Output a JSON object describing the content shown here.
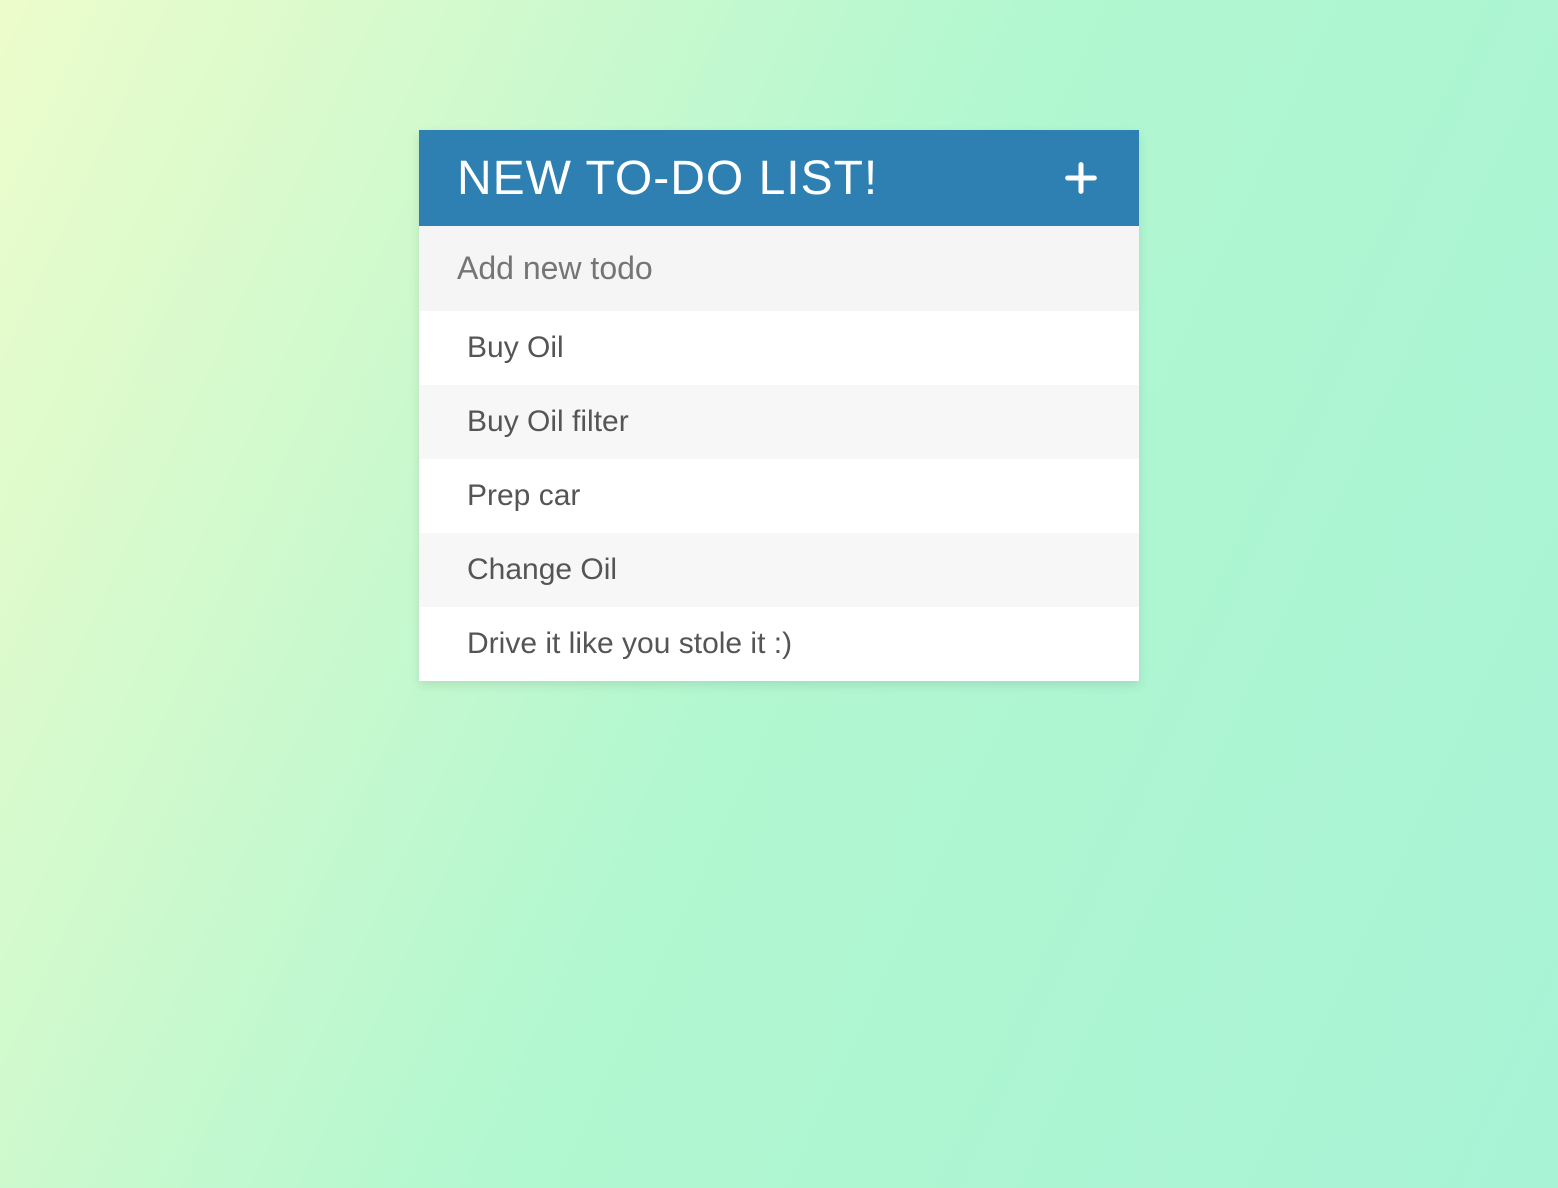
{
  "header": {
    "title": "NEW TO-DO LIST!"
  },
  "input": {
    "placeholder": "Add new todo",
    "value": ""
  },
  "todos": [
    {
      "label": "Buy Oil"
    },
    {
      "label": "Buy Oil filter"
    },
    {
      "label": "Prep car"
    },
    {
      "label": "Change Oil"
    },
    {
      "label": "Drive it like you stole it :)"
    }
  ]
}
